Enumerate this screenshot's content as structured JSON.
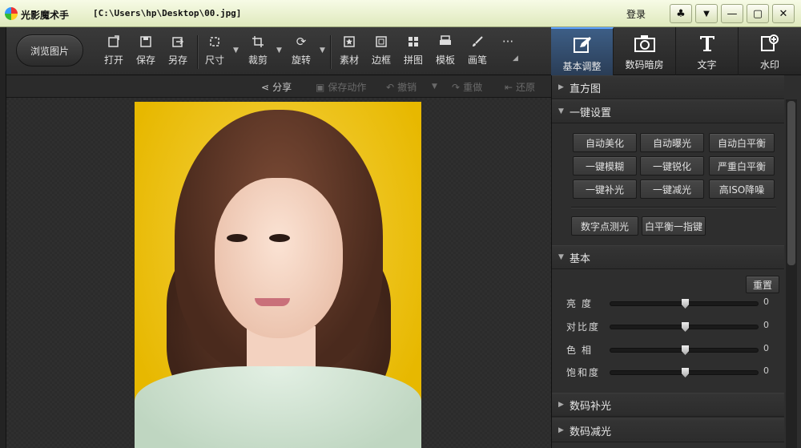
{
  "titlebar": {
    "app_name": "光影魔术手",
    "file_path": "[C:\\Users\\hp\\Desktop\\00.jpg]",
    "login_label": "登录",
    "controls": {
      "skin": "♣",
      "menu": "▼",
      "minimize": "—",
      "maximize": "▢",
      "close": "✕"
    }
  },
  "toolbar": {
    "browse_label": "浏览图片",
    "tools": [
      {
        "label": "打开",
        "icon": "open-icon"
      },
      {
        "label": "保存",
        "icon": "save-icon"
      },
      {
        "label": "另存",
        "icon": "save-as-icon"
      },
      {
        "label": "尺寸",
        "icon": "resize-icon"
      },
      {
        "label": "裁剪",
        "icon": "crop-icon"
      },
      {
        "label": "旋转",
        "icon": "rotate-icon"
      },
      {
        "label": "素材",
        "icon": "material-icon"
      },
      {
        "label": "边框",
        "icon": "border-icon"
      },
      {
        "label": "拼图",
        "icon": "collage-icon"
      },
      {
        "label": "模板",
        "icon": "template-icon"
      },
      {
        "label": "画笔",
        "icon": "brush-icon"
      }
    ],
    "more_label": "···"
  },
  "tabs": [
    {
      "label": "基本调整",
      "icon": "edit-icon",
      "active": true
    },
    {
      "label": "数码暗房",
      "icon": "camera-icon",
      "active": false
    },
    {
      "label": "文字",
      "icon": "text-icon",
      "active": false
    },
    {
      "label": "水印",
      "icon": "watermark-icon",
      "active": false
    }
  ],
  "subbar": {
    "share": "分享",
    "save_action": "保存动作",
    "undo": "撤销",
    "redo": "重做",
    "restore": "还原"
  },
  "panel": {
    "histogram": "直方图",
    "one_click": {
      "title": "一键设置",
      "buttons": [
        "自动美化",
        "自动曝光",
        "自动白平衡",
        "一键模糊",
        "一键锐化",
        "严重白平衡",
        "一键补光",
        "一键减光",
        "高ISO降噪"
      ],
      "extra_buttons": [
        "数字点测光",
        "白平衡一指键"
      ]
    },
    "basic": {
      "title": "基本",
      "reset": "重置",
      "sliders": [
        {
          "label": "亮度",
          "value": "0"
        },
        {
          "label": "对比度",
          "value": "0"
        },
        {
          "label": "色相",
          "value": "0"
        },
        {
          "label": "饱和度",
          "value": "0"
        }
      ]
    },
    "digital_fill": "数码补光",
    "digital_reduce": "数码减光"
  },
  "colors": {
    "accent": "#5da2ff",
    "photo_bg": "#f0c51c"
  }
}
